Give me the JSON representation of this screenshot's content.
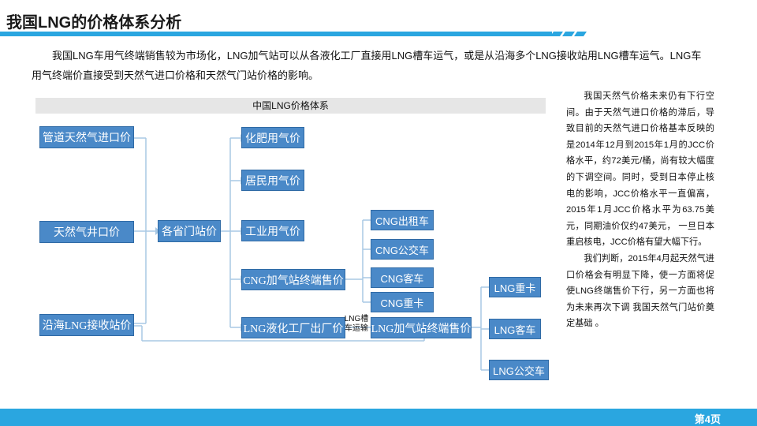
{
  "title": "我国LNG的价格体系分析",
  "intro": "我国LNG车用气终端销售较为市场化，LNG加气站可以从各液化工厂直接用LNG槽车运气，或是从沿海多个LNG接收站用LNG槽车运气。LNG车用气终端价直接受到天然气进口价格和天然气门站价格的影响。",
  "diagram": {
    "header": "中国LNG价格体系",
    "sources": [
      "管道天然气进口价",
      "天然气井口价",
      "沿海LNG接收站价"
    ],
    "hub": "各省门站价",
    "uses": [
      "化肥用气价",
      "居民用气价",
      "工业用气价",
      "CNG加气站终端售价",
      "LNG液化工厂出厂价"
    ],
    "cng_types": [
      "CNG出租车",
      "CNG公交车",
      "CNG客车",
      "CNG重卡"
    ],
    "lng_station": "LNG加气站终端售价",
    "transport_label": "LNG槽车运输",
    "lng_types": [
      "LNG重卡",
      "LNG客车",
      "LNG公交车"
    ]
  },
  "side_text": [
    "我国天然气价格未来仍有下行空间。由于天然气进口价格的滞后，导致目前的天然气进口价格基本反映的是2014年12月到2015年1月的JCC价格水平，约72美元/桶，尚有较大幅度的下调空间。同时，受到日本停止核电的影响，JCC价格水平一直偏高，2015年1月JCC价格水平为63.75美元，同期油价仅约47美元， 一旦日本重启核电，JCC价格有望大幅下行。",
    "我们判断，2015年4月起天然气进口价格会有明显下降，使一方面将促使LNG终端售价下行，另一方面也将为未来再次下调 我国天然气门站价奠定基础 。"
  ],
  "page_number": "第4页",
  "colors": {
    "accent": "#2aa6e0",
    "box_fill": "#4a89c8",
    "box_border": "#2f6aa5",
    "line": "#a8c8e4"
  }
}
